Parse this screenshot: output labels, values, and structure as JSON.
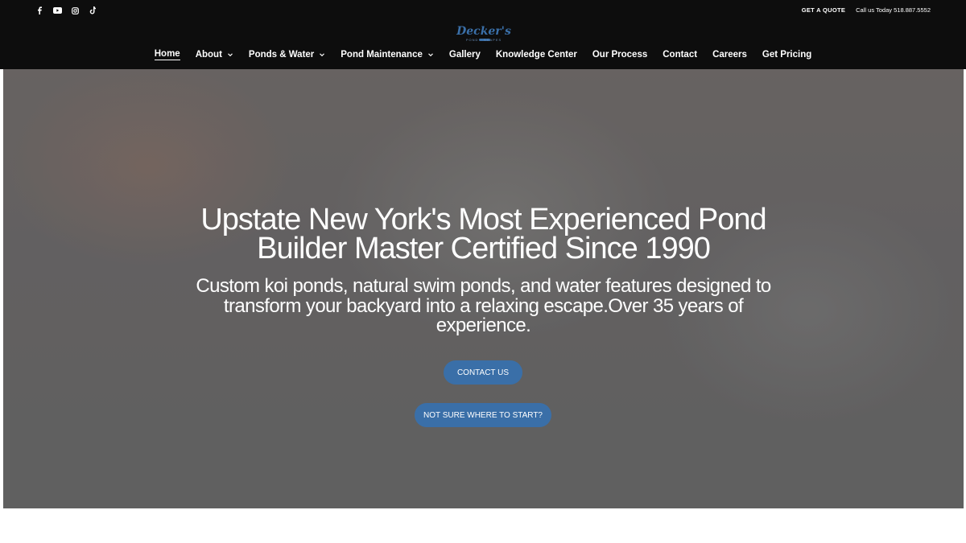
{
  "header": {
    "social_icons": [
      "facebook-icon",
      "youtube-icon",
      "instagram-icon",
      "tiktok-icon"
    ],
    "quote_label": "GET A QUOTE",
    "call_label": "Call us Today 518.887.5552",
    "logo_text": "Decker's",
    "logo_sub": "POND · SCAPES"
  },
  "nav": {
    "items": [
      {
        "label": "Home",
        "active": true
      },
      {
        "label": "About",
        "dropdown": true
      },
      {
        "label": "Ponds & Water",
        "dropdown": true
      },
      {
        "label": "Pond Maintenance",
        "dropdown": true
      },
      {
        "label": "Gallery"
      },
      {
        "label": "Knowledge Center"
      },
      {
        "label": "Our Process"
      },
      {
        "label": "Contact"
      },
      {
        "label": "Careers"
      },
      {
        "label": "Get Pricing"
      }
    ]
  },
  "hero": {
    "title": "Upstate New York's Most Experienced Pond Builder Master Certified Since 1990",
    "subtitle": "Custom koi ponds, natural swim ponds, and water features designed to transform your backyard into a relaxing escape.Over 35 years of experience.",
    "contact_button": "CONTACT US",
    "start_button": "NOT SURE WHERE TO START?"
  },
  "colors": {
    "header_bg": "#0d0d0d",
    "accent": "#3a6fa8",
    "text": "#ffffff"
  }
}
